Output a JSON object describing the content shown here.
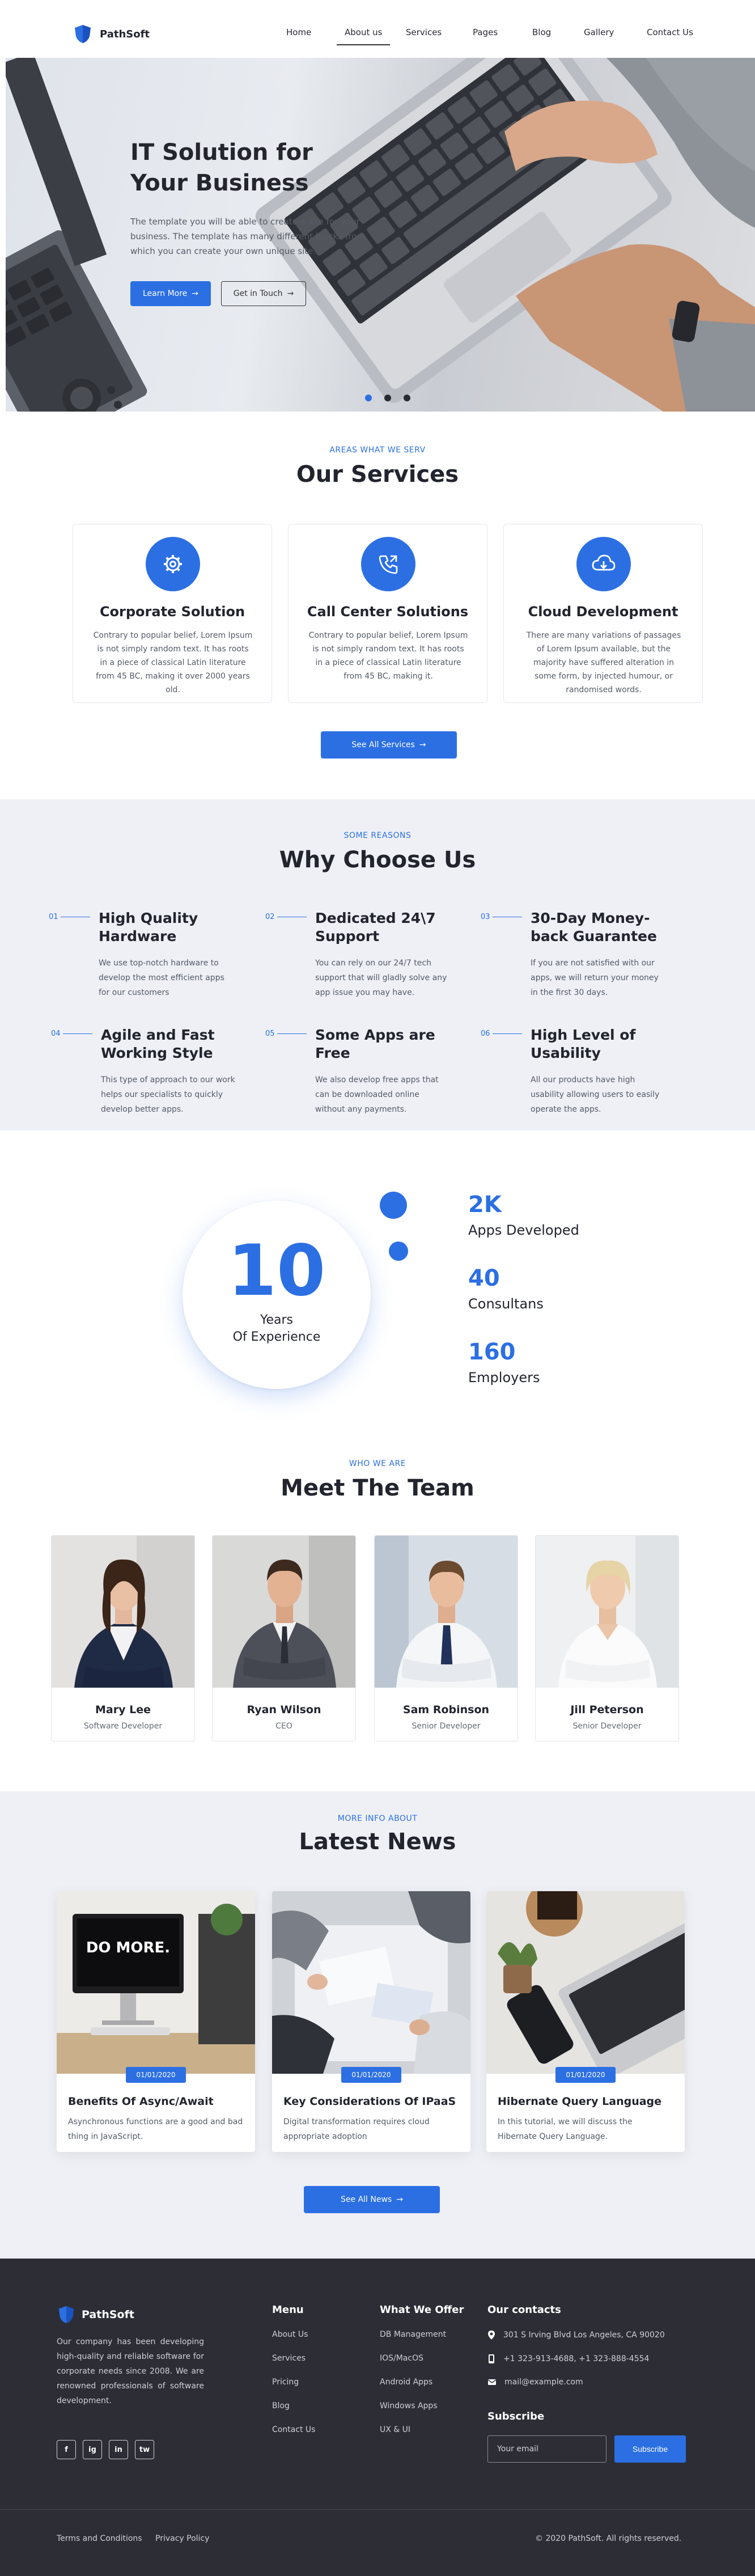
{
  "header": {
    "brand": "PathSoft",
    "nav": [
      "Home",
      "About us",
      "Services",
      "Pages",
      "Blog",
      "Gallery",
      "Contact Us"
    ]
  },
  "hero": {
    "title": "IT Solution for Your Business",
    "text": "The template you will be able to create a site for your business. The template has many different blocks from which you can create your own unique site.",
    "primary_label": "Learn More",
    "secondary_label": "Get in Touch",
    "slide_count": 3,
    "active_slide": 1
  },
  "services": {
    "eyebrow": "AREAS WHAT WE SERV",
    "title": "Our Services",
    "items": [
      {
        "icon": "gear-icon",
        "title": "Corporate Solution",
        "desc": "Contrary to popular belief, Lorem Ipsum is not simply random text. It has roots in a piece of classical Latin literature from 45 BC, making it over 2000 years old."
      },
      {
        "icon": "phone-icon",
        "title": "Call Center Solutions",
        "desc": "Contrary to popular belief, Lorem Ipsum is not simply random text. It has roots in a piece of classical Latin literature from 45 BC, making it."
      },
      {
        "icon": "cloud-download-icon",
        "title": "Cloud Development",
        "desc": "There are many variations of passages of Lorem Ipsum available, but the majority have suffered alteration in some form, by injected humour, or randomised words."
      }
    ],
    "cta": "See All Services"
  },
  "why": {
    "eyebrow": "SOME REASONS",
    "title": "Why Choose Us",
    "items": [
      {
        "num": "01",
        "title": "High Quality Hardware",
        "desc": "We use top-notch hardware to develop the most efficient apps for our customers"
      },
      {
        "num": "02",
        "title": "Dedicated 24\\7 Support",
        "desc": "You can rely on our 24/7 tech support that will gladly solve any app issue you may have."
      },
      {
        "num": "03",
        "title": "30-Day Money-back Guarantee",
        "desc": "If you are not satisfied with our apps, we will return your money in the first 30 days."
      },
      {
        "num": "04",
        "title": "Agile and Fast Working Style",
        "desc": "This type of approach to our work helps our specialists to quickly develop better apps."
      },
      {
        "num": "05",
        "title": "Some Apps are Free",
        "desc": "We also develop free apps that can be downloaded online without any payments."
      },
      {
        "num": "06",
        "title": "High Level of Usability",
        "desc": "All our products have high usability allowing users to easily operate the apps."
      }
    ]
  },
  "stats": {
    "years_value": "10",
    "years_label_1": "Years",
    "years_label_2": "Of Experience",
    "items": [
      {
        "value": "2K",
        "label": "Apps Developed"
      },
      {
        "value": "40",
        "label": "Consultans"
      },
      {
        "value": "160",
        "label": "Employers"
      }
    ]
  },
  "team": {
    "eyebrow": "WHO WE ARE",
    "title": "Meet The Team",
    "members": [
      {
        "name": "Mary Lee",
        "role": "Software Developer"
      },
      {
        "name": "Ryan Wilson",
        "role": "CEO"
      },
      {
        "name": "Sam Robinson",
        "role": "Senior Developer"
      },
      {
        "name": "Jill Peterson",
        "role": "Senior Developer"
      }
    ]
  },
  "news": {
    "eyebrow": "MORE INFO ABOUT",
    "title": "Latest News",
    "posts": [
      {
        "date": "01/01/2020",
        "title": "Benefits Of Async/Await",
        "desc": "Asynchronous functions are a good and bad thing in JavaScript.",
        "img_text": "DO MORE."
      },
      {
        "date": "01/01/2020",
        "title": "Key Considerations Of IPaaS",
        "desc": "Digital transformation requires cloud appropriate adoption"
      },
      {
        "date": "01/01/2020",
        "title": "Hibernate Query Language",
        "desc": "In this tutorial, we will discuss the Hibernate Query Language."
      }
    ],
    "cta": "See All News"
  },
  "footer": {
    "brand": "PathSoft",
    "about": "Our company has been developing high-quality and reliable software for corporate needs since 2008. We are renowned professionals of software development.",
    "socials": [
      "f",
      "ig",
      "in",
      "tw"
    ],
    "menu_title": "Menu",
    "menu": [
      "About Us",
      "Services",
      "Pricing",
      "Blog",
      "Contact Us"
    ],
    "offer_title": "What We Offer",
    "offer": [
      "DB Management",
      "IOS/MacOS",
      "Android Apps",
      "Windows Apps",
      "UX & UI"
    ],
    "contacts_title": "Our contacts",
    "address": "301 S Irving Blvd Los Angeles, CA 90020",
    "phones": "+1 323-913-4688, +1 323-888-4554",
    "email": "mail@example.com",
    "subscribe_title": "Subscribe",
    "email_placeholder": "Your email",
    "subscribe_label": "Subscribe",
    "terms": "Terms and Conditions",
    "privacy": "Privacy Policy",
    "copyright": "© 2020 PathSoft. All rights reserved."
  },
  "colors": {
    "accent": "#2b6fe3",
    "footer_bg": "#2d2d36",
    "soft_bg": "#eef0f6"
  }
}
